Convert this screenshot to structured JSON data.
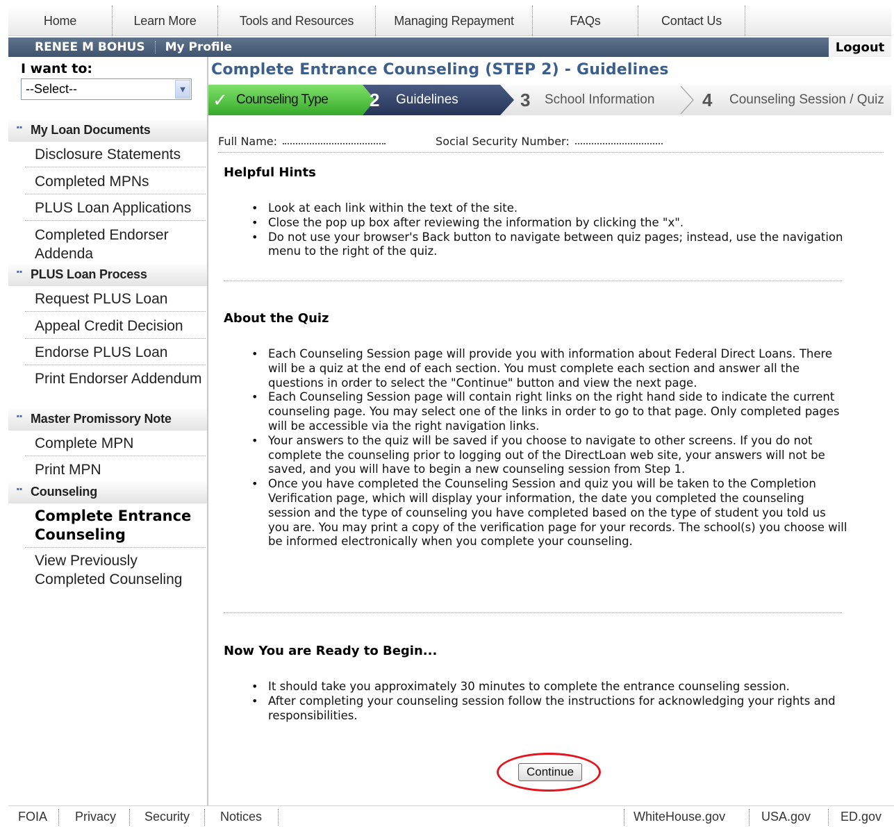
{
  "topnav": {
    "items": [
      "Home",
      "Learn More",
      "Tools and Resources",
      "Managing Repayment",
      "FAQs",
      "Contact Us"
    ]
  },
  "userbar": {
    "name": "RENEE M BOHUS",
    "profile": "My Profile",
    "logout": "Logout"
  },
  "sidebar": {
    "i_want_to": "I want to:",
    "select_value": "--Select--",
    "sections": [
      {
        "title": "My Loan Documents",
        "links": [
          "Disclosure Statements",
          "Completed MPNs",
          "PLUS Loan Applications",
          "Completed Endorser Addenda"
        ]
      },
      {
        "title": "PLUS Loan Process",
        "links": [
          "Request PLUS Loan",
          "Appeal Credit Decision",
          "Endorse PLUS Loan",
          "Print Endorser Addendum"
        ]
      },
      {
        "title": "Master Promissory Note",
        "links": [
          "Complete MPN",
          "Print MPN"
        ]
      },
      {
        "title": "Counseling",
        "links": [
          "Complete Entrance Counseling",
          "View Previously Completed Counseling"
        ]
      }
    ]
  },
  "main": {
    "title": "Complete Entrance Counseling (STEP 2) - Guidelines",
    "steps": [
      {
        "num": "",
        "label": "Counseling Type"
      },
      {
        "num": "2",
        "label": "Guidelines"
      },
      {
        "num": "3",
        "label": "School Information"
      },
      {
        "num": "4",
        "label": "Counseling Session / Quiz"
      }
    ],
    "full_name_label": "Full Name:",
    "ssn_label": "Social Security Number:",
    "helpful_hints_title": "Helpful Hints",
    "helpful_hints": [
      "Look at each link within the text of the site.",
      "Close the pop up box after reviewing the information by clicking the \"x\".",
      "Do not use your browser's Back button to navigate between quiz pages; instead, use the navigation menu to the right of the quiz."
    ],
    "about_quiz_title": "About the Quiz",
    "about_quiz": [
      "Each Counseling Session page will provide you with information about Federal Direct Loans. There will be a quiz at the end of each section. You must complete each section and answer all the questions in order to select the \"Continue\" button and view the next page.",
      "Each Counseling Session page will contain right links on the right hand side to indicate the current counseling page. You may select one of the links in order to go to that page. Only completed pages will be accessible via the right navigation links.",
      "Your answers to the quiz will be saved if you choose to navigate to other screens. If you do not complete the counseling prior to logging out of the DirectLoan web site, your answers will not be saved, and you will have to begin a new counseling session from Step 1.",
      "Once you have completed the Counseling Session and quiz you will be taken to the Completion Verification page, which will display your information, the date you completed the counseling session and the type of counseling you have completed based on the type of student you told us you are. You may print a copy of the verification page for your records. The school(s) you choose will be informed electronically when you complete your counseling."
    ],
    "ready_title": "Now You are Ready to Begin...",
    "ready": [
      "It should take you approximately 30 minutes to complete the entrance counseling session.",
      "After completing your counseling session follow the instructions for acknowledging your rights and responsibilities."
    ],
    "continue_label": "Continue"
  },
  "footer": {
    "left": [
      "FOIA",
      "Privacy",
      "Security",
      "Notices"
    ],
    "right": [
      "WhiteHouse.gov",
      "USA.gov",
      "ED.gov"
    ]
  },
  "colors": {
    "title_blue": "#3b5f8c",
    "userbar": "#4a5f7c",
    "step_active_green": "#4cc13a",
    "step_current_navy": "#34456b",
    "highlight_red": "#e3141e"
  }
}
